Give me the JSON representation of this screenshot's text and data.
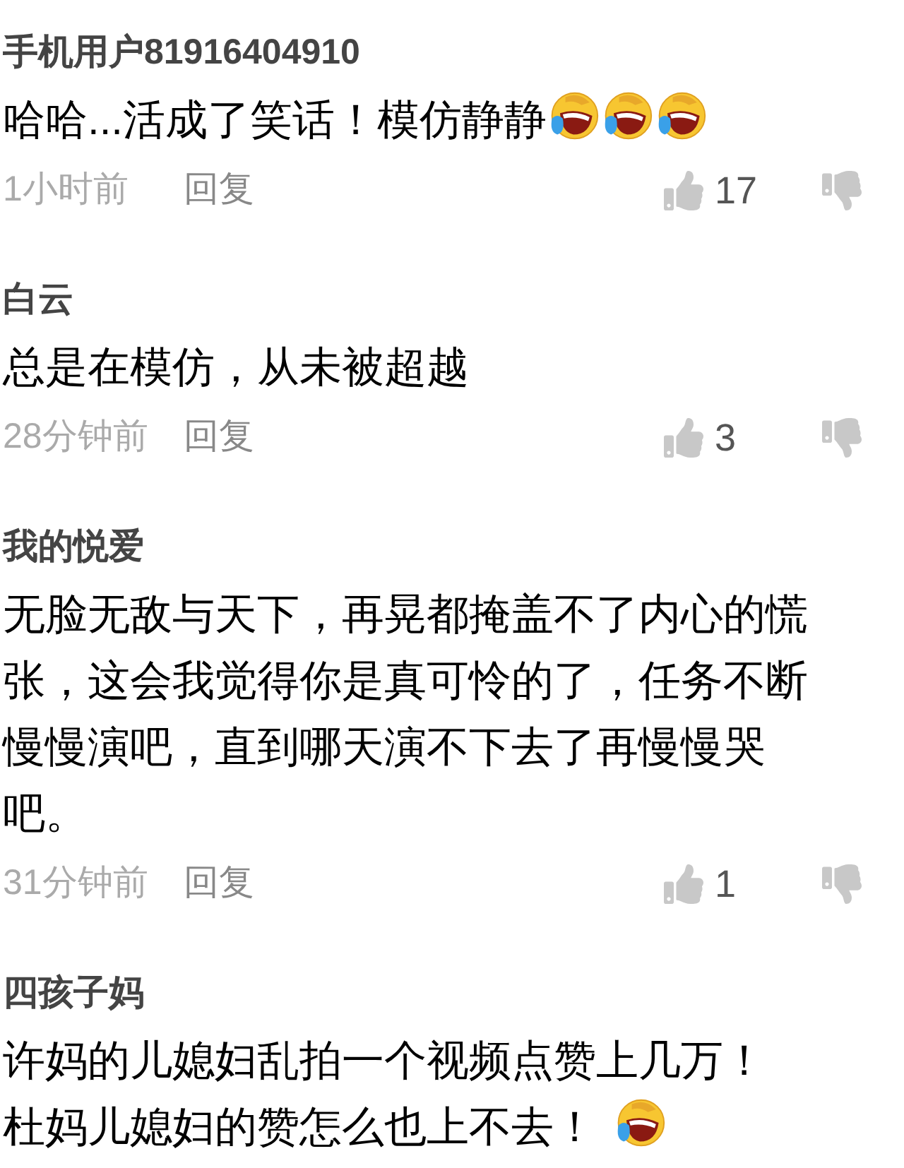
{
  "comments": [
    {
      "user": "手机用户81916404910",
      "body": [
        {
          "kind": "text",
          "text": "哈哈...活成了笑话！模仿静静"
        },
        {
          "kind": "emoji"
        },
        {
          "kind": "emoji"
        },
        {
          "kind": "emoji"
        }
      ],
      "time": "1小时前",
      "reply": "回复",
      "likes": "17"
    },
    {
      "user": "白云",
      "body": [
        {
          "kind": "text",
          "text": "总是在模仿，从未被超越"
        }
      ],
      "time": "28分钟前",
      "reply": "回复",
      "likes": "3"
    },
    {
      "user": "我的悦爱",
      "body": [
        {
          "kind": "text",
          "text": "无脸无敌与天下，再晃都掩盖不了内心的慌张，这会我觉得你是真可怜的了，任务不断慢慢演吧，直到哪天演不下去了再慢慢哭吧。"
        }
      ],
      "time": "31分钟前",
      "reply": "回复",
      "likes": "1"
    },
    {
      "user": "四孩子妈",
      "body": [
        {
          "kind": "text",
          "text": "许妈的儿媳妇乱拍一个视频点赞上几万！"
        },
        {
          "kind": "break"
        },
        {
          "kind": "text",
          "text": "杜妈儿媳妇的赞怎么也上不去！"
        },
        {
          "kind": "space"
        },
        {
          "kind": "emoji"
        }
      ]
    }
  ]
}
